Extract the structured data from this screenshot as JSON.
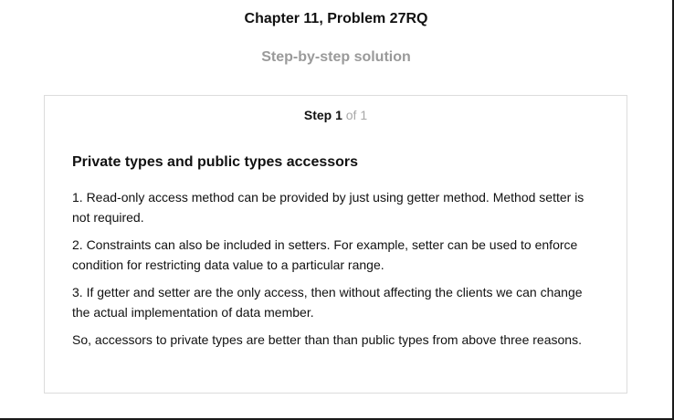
{
  "header": {
    "title": "Chapter 11, Problem 27RQ",
    "subtitle": "Step-by-step solution"
  },
  "step": {
    "label": "Step 1",
    "total": "of 1",
    "heading": "Private types and public types accessors",
    "paragraphs": [
      "1. Read-only access method can be provided by just using getter method. Method setter is not required.",
      "2. Constraints can also be included in setters. For example, setter can be used to enforce condition for restricting data value to a particular range.",
      "3. If getter and setter are the only access, then without affecting the clients we can change the actual implementation of data member.",
      "So, accessors to private types are better than than public types from above three reasons."
    ]
  }
}
